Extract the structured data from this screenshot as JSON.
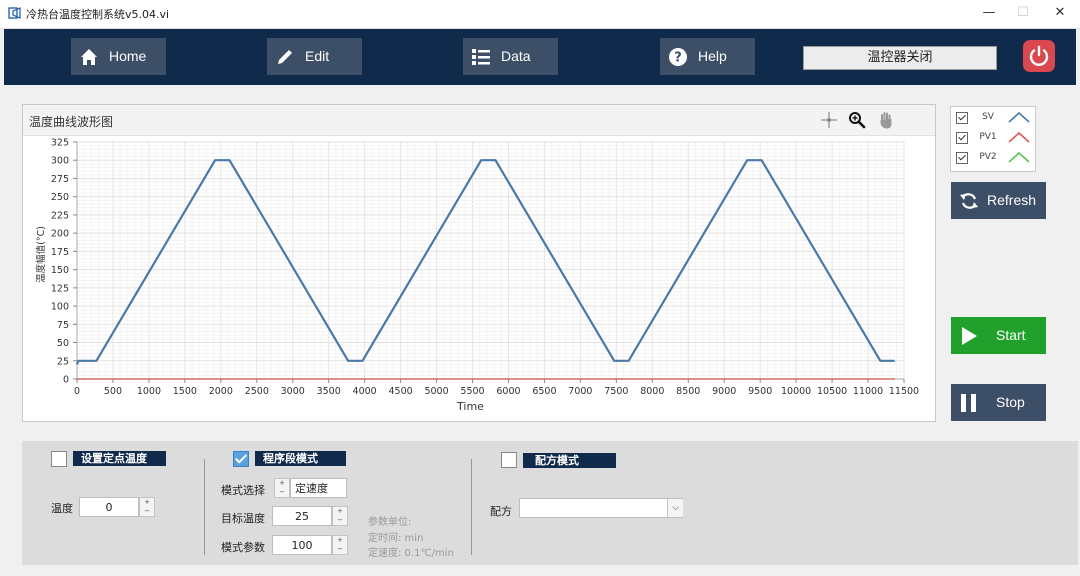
{
  "window": {
    "title": "冷热台温度控制系统v5.04.vi",
    "minimize": "—",
    "maximize": "☐",
    "close": "✕"
  },
  "toolbar": {
    "home": "Home",
    "edit": "Edit",
    "data": "Data",
    "help": "Help",
    "status": "温控器关闭"
  },
  "chart": {
    "panel_title": "温度曲线波形图"
  },
  "legend": [
    {
      "name": "SV",
      "color": "#4a79a8"
    },
    {
      "name": "PV1",
      "color": "#e05757"
    },
    {
      "name": "PV2",
      "color": "#5cc05c"
    }
  ],
  "side_buttons": {
    "refresh": "Refresh",
    "start": "Start",
    "stop": "Stop"
  },
  "bottom": {
    "fixed": {
      "title": "设置定点温度",
      "checked": false,
      "temp_label": "温度",
      "temp_value": "0"
    },
    "program": {
      "title": "程序段模式",
      "checked": true,
      "mode_label": "模式选择",
      "mode_value": "定速度",
      "target_label": "目标温度",
      "target_value": "25",
      "param_label": "模式参数",
      "param_value": "100",
      "hint_title": "参数单位:",
      "hint_time": "定时间: min",
      "hint_speed": "定速度: 0.1℃/min"
    },
    "recipe": {
      "title": "配方模式",
      "checked": false,
      "label": "配方",
      "value": ""
    }
  },
  "chart_data": {
    "type": "line",
    "title": "",
    "xlabel": "Time",
    "ylabel": "温度幅值(°C)",
    "xlim": [
      0,
      11500
    ],
    "ylim": [
      0,
      325
    ],
    "xticks": [
      0,
      500,
      1000,
      1500,
      2000,
      2500,
      3000,
      3500,
      4000,
      4500,
      5000,
      5500,
      6000,
      6500,
      7000,
      7500,
      8000,
      8500,
      9000,
      9500,
      10000,
      10500,
      11000,
      11500
    ],
    "yticks": [
      0,
      25,
      50,
      75,
      100,
      125,
      150,
      175,
      200,
      225,
      250,
      275,
      300,
      325
    ],
    "grid": true,
    "series": [
      {
        "name": "SV",
        "color": "#4a79a8",
        "x": [
          0,
          20,
          270,
          1920,
          2120,
          3770,
          3970,
          5620,
          5820,
          7470,
          7670,
          9320,
          9520,
          11170,
          11370
        ],
        "y": [
          20,
          25,
          25,
          300,
          300,
          25,
          25,
          300,
          300,
          25,
          25,
          300,
          300,
          25,
          25
        ]
      },
      {
        "name": "PV1",
        "color": "#e05757",
        "x": [
          0,
          11370
        ],
        "y": [
          0,
          0
        ]
      },
      {
        "name": "PV2",
        "color": "#5cc05c",
        "x": [
          0,
          11370
        ],
        "y": [
          0,
          0
        ]
      }
    ]
  }
}
